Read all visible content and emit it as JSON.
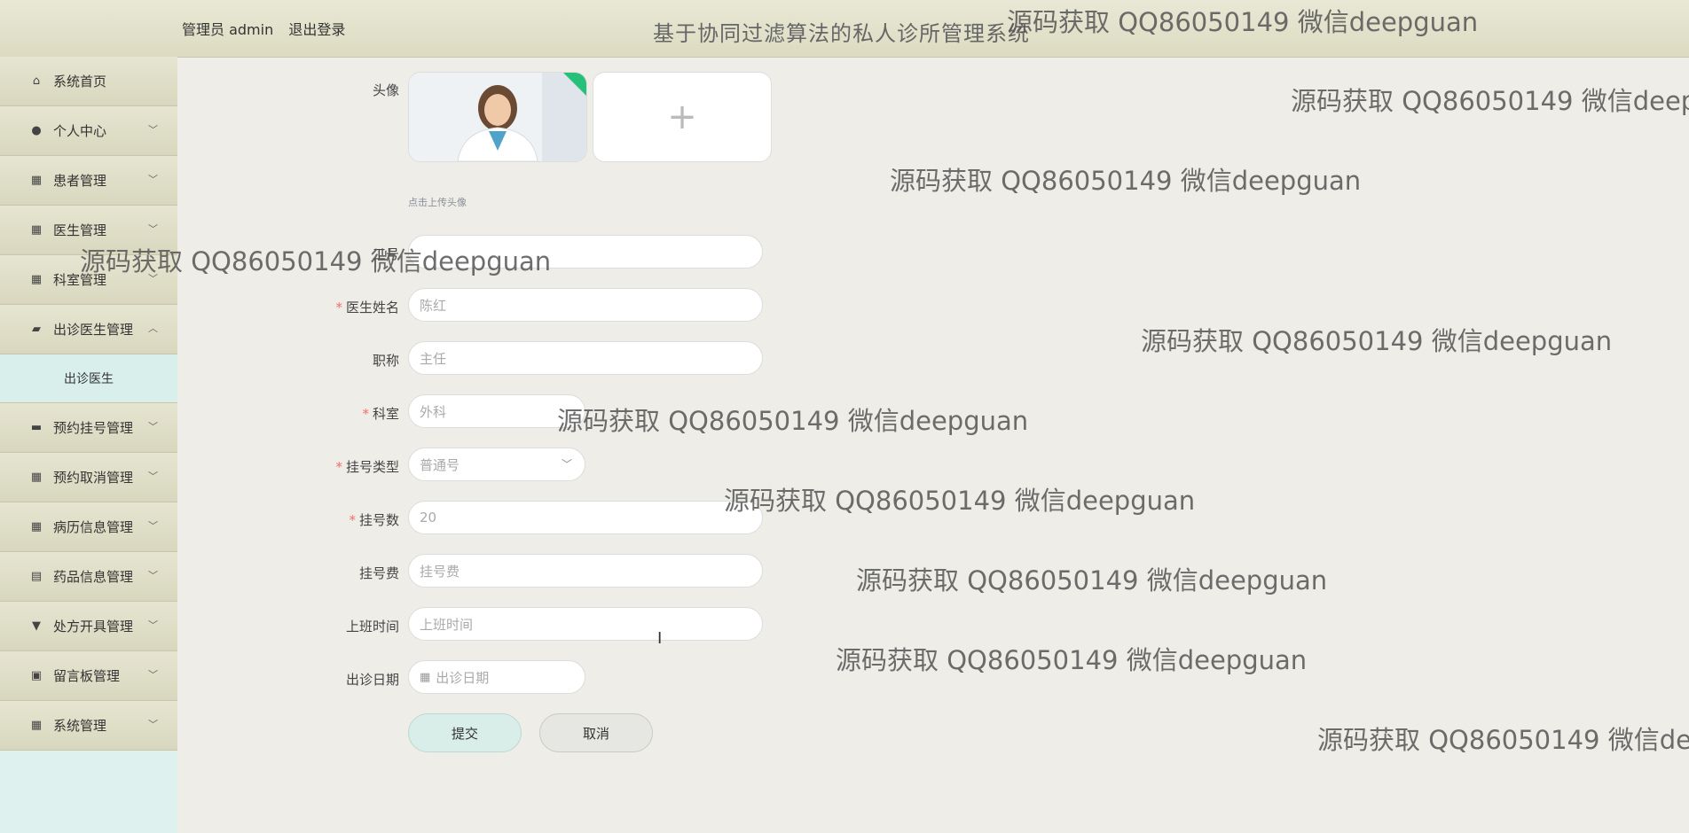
{
  "header": {
    "user_role": "管理员 admin",
    "logout_label": "退出登录",
    "app_title": "基于协同过滤算法的私人诊所管理系统"
  },
  "sidebar": {
    "items": [
      {
        "label": "系统首页",
        "icon": "home-icon"
      },
      {
        "label": "个人中心",
        "icon": "user-icon"
      },
      {
        "label": "患者管理",
        "icon": "grid-icon"
      },
      {
        "label": "医生管理",
        "icon": "grid-icon"
      },
      {
        "label": "科室管理",
        "icon": "grid-icon"
      },
      {
        "label": "出诊医生管理",
        "icon": "briefcase-icon",
        "expanded": true
      },
      {
        "label": "出诊医生",
        "icon": "",
        "submenu": true
      },
      {
        "label": "预约挂号管理",
        "icon": "monitor-icon"
      },
      {
        "label": "预约取消管理",
        "icon": "grid-icon"
      },
      {
        "label": "病历信息管理",
        "icon": "grid-icon"
      },
      {
        "label": "药品信息管理",
        "icon": "clipboard-icon"
      },
      {
        "label": "处方开具管理",
        "icon": "bookmark-icon"
      },
      {
        "label": "留言板管理",
        "icon": "document-icon"
      },
      {
        "label": "系统管理",
        "icon": "apps-icon"
      }
    ]
  },
  "form": {
    "avatar_label": "头像",
    "upload_tip": "点击上传头像",
    "field_ghost_label": "工号",
    "doctor_name_label": "医生姓名",
    "doctor_name_value": "陈红",
    "title_label": "职称",
    "title_value": "主任",
    "department_label": "科室",
    "department_value": "外科",
    "reg_type_label": "挂号类型",
    "reg_type_value": "普通号",
    "reg_count_label": "挂号数",
    "reg_count_value": "20",
    "reg_fee_label": "挂号费",
    "reg_fee_placeholder": "挂号费",
    "work_time_label": "上班时间",
    "work_time_placeholder": "上班时间",
    "visit_date_label": "出诊日期",
    "visit_date_placeholder": "出诊日期",
    "submit_label": "提交",
    "cancel_label": "取消"
  },
  "watermark": "源码获取 QQ86050149 微信deepguan"
}
